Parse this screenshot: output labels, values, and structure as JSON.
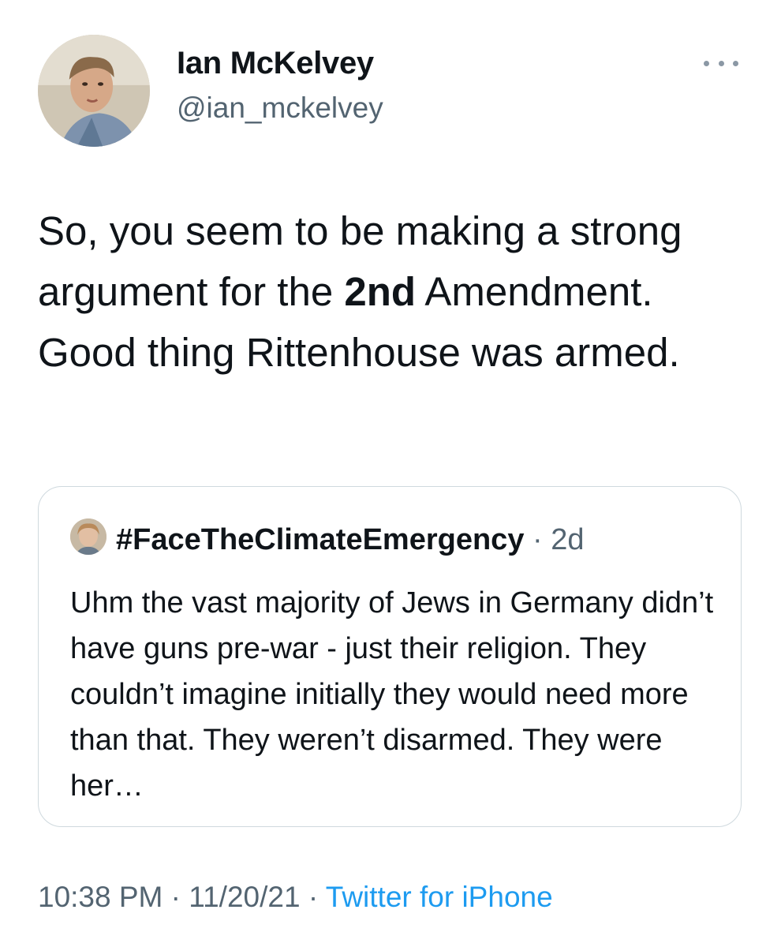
{
  "author": {
    "name": "Ian McKelvey",
    "handle": "@ian_mckelvey"
  },
  "tweet": {
    "text_before_bold": "So, you seem to be making a strong argument for the ",
    "text_bold": "2nd",
    "text_after_bold": " Amendment. Good thing Rittenhouse was armed."
  },
  "quoted_tweet": {
    "name": "#FaceTheClimateEmergency",
    "separator": " · ",
    "time": "2d",
    "text": "Uhm the vast majority of Jews in Germany didn’t have guns pre-war - just their religion. They couldn’t imagine initially they would need more than that. They weren’t disarmed. They were her…"
  },
  "footer": {
    "time": "10:38 PM",
    "separator_1": " · ",
    "date": "11/20/21",
    "separator_2": " · ",
    "source": "Twitter for iPhone"
  },
  "icons": {
    "more": "more-options-icon"
  },
  "colors": {
    "text_primary": "#0f1419",
    "text_secondary": "#536471",
    "link": "#1d9bf0",
    "border": "#cfd9de"
  }
}
